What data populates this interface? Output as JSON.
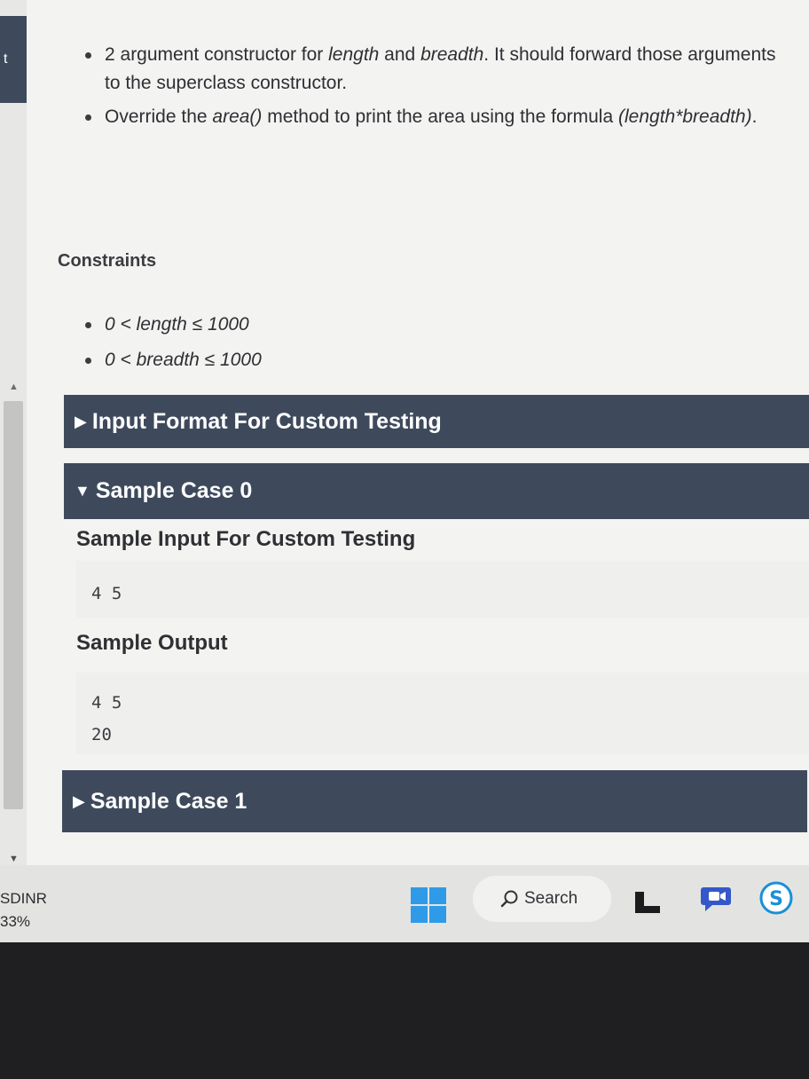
{
  "left_panel": {
    "tab_letter": "t",
    "bottom_label": "SDINR",
    "bottom_percent": "33%"
  },
  "description": {
    "bullets": [
      {
        "before": "2 argument constructor for ",
        "em1": "length",
        "mid": " and ",
        "em2": "breadth",
        "after": ". It should forward those arguments to the superclass constructor."
      },
      {
        "before": "Override the ",
        "em1": "area()",
        "mid": " method to print the area using the formula ",
        "em2": "(length*breadth)",
        "after": "."
      }
    ]
  },
  "constraints": {
    "title": "Constraints",
    "items": [
      "0 < length ≤ 1000",
      "0 < breadth ≤ 1000"
    ]
  },
  "sections": {
    "input_format": {
      "label": "Input Format For Custom Testing",
      "expanded": false
    },
    "sample_case_0": {
      "label": "Sample Case 0",
      "expanded": true
    },
    "sample_case_1": {
      "label": "Sample Case 1",
      "expanded": false
    }
  },
  "sample_case_0": {
    "input_heading": "Sample Input For Custom Testing",
    "input_lines": [
      "4 5"
    ],
    "output_heading": "Sample Output",
    "output_lines": [
      "4 5",
      "20"
    ]
  },
  "taskbar": {
    "search_label": "Search",
    "icons": [
      "windows-start-icon",
      "file-explorer-icon",
      "meet-icon",
      "skype-icon"
    ]
  },
  "colors": {
    "section_bar": "#3e4a5c",
    "windows_blue": "#2f9be8",
    "skype_blue": "#1a8fd6"
  }
}
